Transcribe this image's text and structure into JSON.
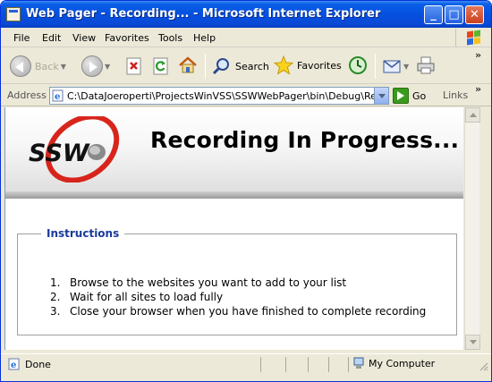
{
  "window": {
    "title": "Web Pager - Recording... - Microsoft Internet Explorer",
    "controls": {
      "minimize": "_",
      "maximize": "□",
      "close": "✕"
    }
  },
  "menu": {
    "items": [
      "File",
      "Edit",
      "View",
      "Favorites",
      "Tools",
      "Help"
    ]
  },
  "toolbar": {
    "back_label": "Back",
    "search_label": "Search",
    "favorites_label": "Favorites",
    "overflow": "»"
  },
  "address": {
    "label": "Address",
    "value": "C:\\DataJoeroperti\\ProjectsWinVSS\\SSWWebPager\\bin\\Debug\\Recording",
    "go_label": "Go",
    "links_label": "Links",
    "overflow": "»"
  },
  "page": {
    "banner_title": "Recording In Progress...",
    "logo_text": "SSW",
    "instructions_legend": "Instructions",
    "steps": [
      {
        "num": "1.",
        "text": "Browse to the websites you want to add to your list"
      },
      {
        "num": "2.",
        "text": "Wait for all sites to load fully"
      },
      {
        "num": "3.",
        "text": "Close your browser when you have finished to complete recording"
      }
    ]
  },
  "status": {
    "text": "Done",
    "zone": "My Computer"
  },
  "colors": {
    "titlebar": "#0550e0",
    "legend": "#1a3a9a",
    "logo_red": "#d8251c"
  }
}
